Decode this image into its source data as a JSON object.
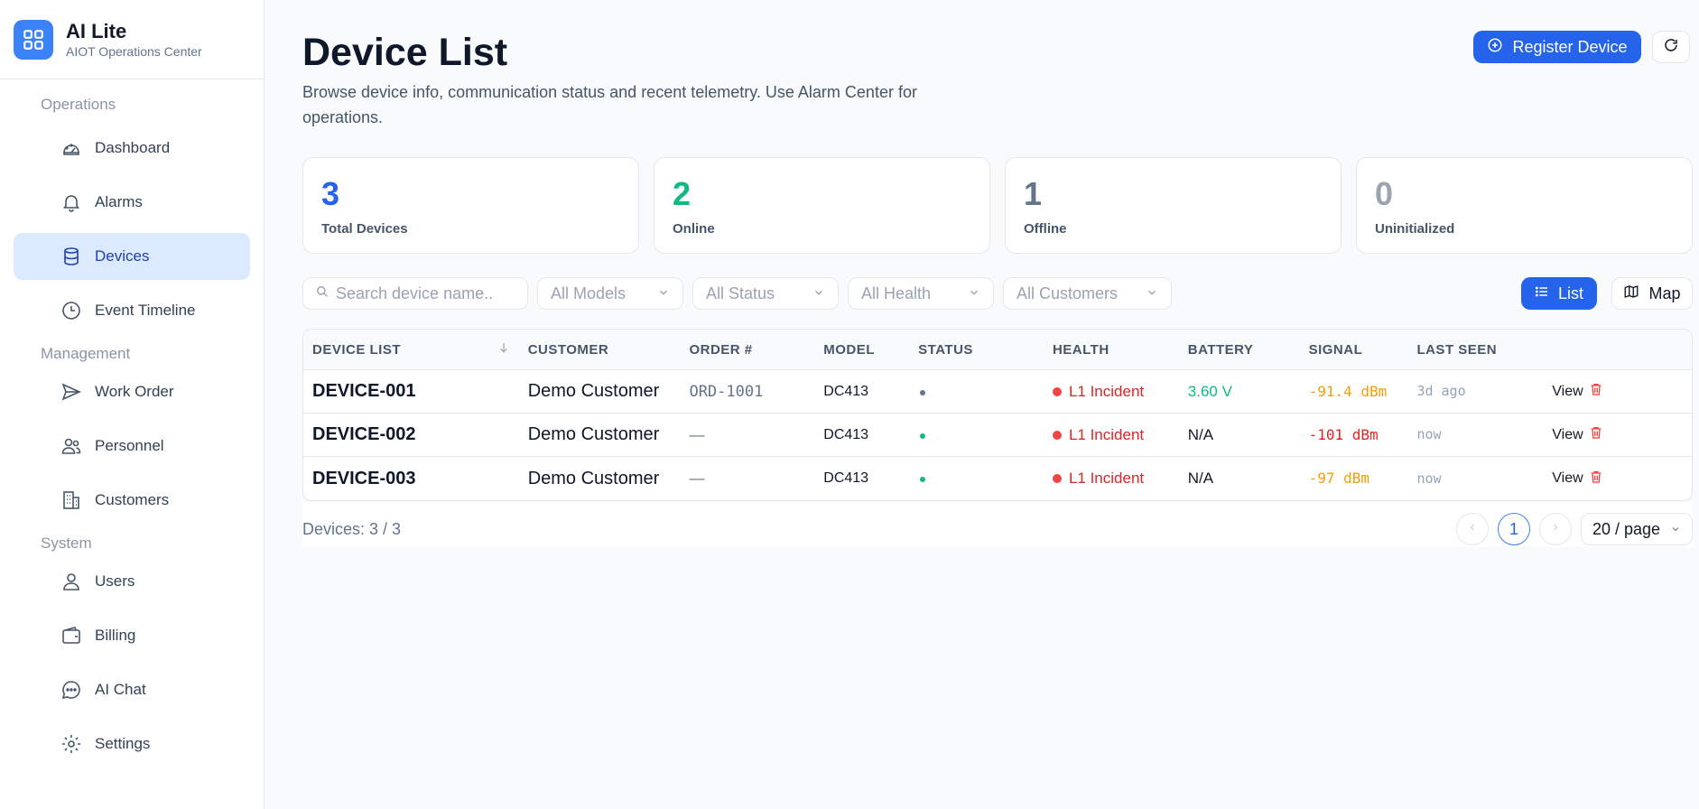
{
  "app": {
    "name": "AI Lite",
    "subtitle": "AIOT Operations Center"
  },
  "sidebar": {
    "sections": [
      {
        "title": "Operations",
        "items": [
          {
            "label": "Dashboard",
            "icon": "dashboard-icon",
            "active": false
          },
          {
            "label": "Alarms",
            "icon": "bell-icon",
            "active": false
          },
          {
            "label": "Devices",
            "icon": "database-icon",
            "active": true
          },
          {
            "label": "Event Timeline",
            "icon": "clock-icon",
            "active": false
          }
        ]
      },
      {
        "title": "Management",
        "items": [
          {
            "label": "Work Order",
            "icon": "send-icon",
            "active": false
          },
          {
            "label": "Personnel",
            "icon": "users-icon",
            "active": false
          },
          {
            "label": "Customers",
            "icon": "building-icon",
            "active": false
          }
        ]
      },
      {
        "title": "System",
        "items": [
          {
            "label": "Users",
            "icon": "user-icon",
            "active": false
          },
          {
            "label": "Billing",
            "icon": "wallet-icon",
            "active": false
          },
          {
            "label": "AI Chat",
            "icon": "chat-icon",
            "active": false
          },
          {
            "label": "Settings",
            "icon": "gear-icon",
            "active": false
          }
        ]
      }
    ]
  },
  "header": {
    "title": "Device List",
    "description": "Browse device info, communication status and recent telemetry. Use Alarm Center for operations.",
    "register_label": "Register Device"
  },
  "stats": [
    {
      "value": "3",
      "label": "Total Devices",
      "color": "#2563eb"
    },
    {
      "value": "2",
      "label": "Online",
      "color": "#10b981"
    },
    {
      "value": "1",
      "label": "Offline",
      "color": "#64748b"
    },
    {
      "value": "0",
      "label": "Uninitialized",
      "color": "#9ca3af"
    }
  ],
  "filters": {
    "search_placeholder": "Search device name..",
    "models": "All Models",
    "status": "All Status",
    "health": "All Health",
    "customers": "All Customers",
    "list_label": "List",
    "map_label": "Map"
  },
  "table": {
    "headers": [
      "DEVICE LIST",
      "CUSTOMER",
      "ORDER #",
      "MODEL",
      "STATUS",
      "HEALTH",
      "BATTERY",
      "SIGNAL",
      "LAST SEEN"
    ],
    "rows": [
      {
        "name": "DEVICE-001",
        "customer": "Demo Customer",
        "order": "ORD-1001",
        "model": "DC413",
        "status_color": "#64748b",
        "health": "L1 Incident",
        "battery": "3.60 V",
        "battery_color": "#10b981",
        "signal": "-91.4 dBm",
        "signal_color": "#f59e0b",
        "last_seen": "3d ago",
        "action": "View"
      },
      {
        "name": "DEVICE-002",
        "customer": "Demo Customer",
        "order": "—",
        "model": "DC413",
        "status_color": "#10b981",
        "health": "L1 Incident",
        "battery": "N/A",
        "battery_color": "#111827",
        "signal": "-101 dBm",
        "signal_color": "#dc2626",
        "last_seen": "now",
        "action": "View"
      },
      {
        "name": "DEVICE-003",
        "customer": "Demo Customer",
        "order": "—",
        "model": "DC413",
        "status_color": "#10b981",
        "health": "L1 Incident",
        "battery": "N/A",
        "battery_color": "#111827",
        "signal": "-97 dBm",
        "signal_color": "#f59e0b",
        "last_seen": "now",
        "action": "View"
      }
    ]
  },
  "footer": {
    "count": "Devices: 3 / 3",
    "page": "1",
    "per_page": "20 / page"
  }
}
